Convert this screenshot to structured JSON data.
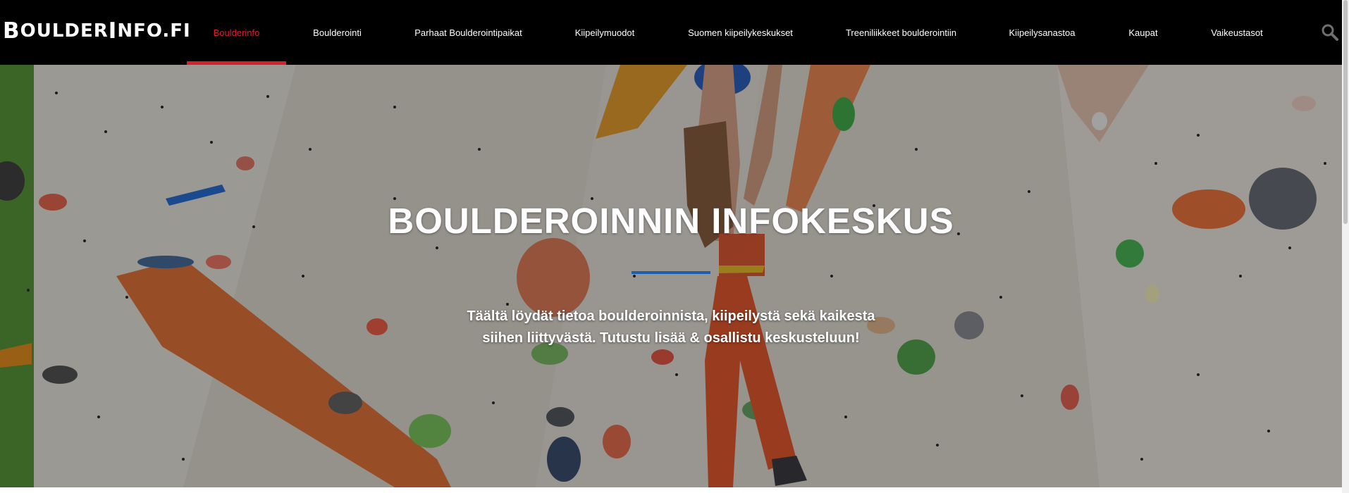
{
  "header": {
    "logo_text": "BoulderInfo.fi",
    "logo_parts": {
      "b": "B",
      "oulder": "OULDER",
      "i": "I",
      "nfo": "NFO.FI"
    },
    "nav": [
      {
        "label": "Boulderinfo",
        "active": true
      },
      {
        "label": "Boulderointi",
        "active": false
      },
      {
        "label": "Parhaat Boulderointipaikat",
        "active": false
      },
      {
        "label": "Kiipeilymuodot",
        "active": false
      },
      {
        "label": "Suomen kiipeilykeskukset",
        "active": false
      },
      {
        "label": "Treeniliikkeet boulderointiin",
        "active": false
      },
      {
        "label": "Kiipeilysanastoa",
        "active": false
      },
      {
        "label": "Kaupat",
        "active": false
      },
      {
        "label": "Vaikeustasot",
        "active": false
      }
    ],
    "search_icon": "search-icon"
  },
  "hero": {
    "title": "BOULDEROINNIN INFOKESKUS",
    "text_line1": "Täältä löydät tietoa boulderoinnista, kiipeilystä sekä kaikesta",
    "text_line2": "siihen liittyvästä. Tutustu lisää & osallistu keskusteluun!",
    "divider_color": "#1e5fab",
    "background_image": "climber-on-bouldering-wall"
  },
  "colors": {
    "header_bg": "#000000",
    "accent": "#d81f2e",
    "text": "#ffffff"
  }
}
